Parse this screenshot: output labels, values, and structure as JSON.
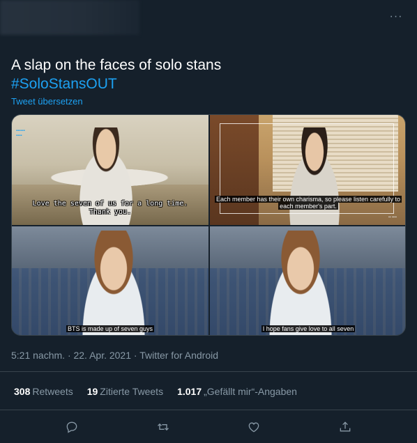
{
  "tweet": {
    "text": "A slap on the faces of solo stans",
    "hashtag": "#SoloStansOUT",
    "translate_label": "Tweet übersetzen",
    "meta": "5:21 nachm. · 22. Apr. 2021 · Twitter for Android"
  },
  "media": {
    "tile1": {
      "subtitle_line1": "Love the seven of us for a long time.",
      "subtitle_line2": "Thank you."
    },
    "tile2": {
      "subtitle_line1": "Each member has their own charisma, so please listen carefully to",
      "subtitle_line2": "each member's part."
    },
    "tile3": {
      "subtitle": "BTS is made up of seven guys"
    },
    "tile4": {
      "subtitle": "I hope fans give love to all seven"
    }
  },
  "stats": {
    "retweets_count": "308",
    "retweets_label": "Retweets",
    "quotes_count": "19",
    "quotes_label": "Zitierte Tweets",
    "likes_count": "1.017",
    "likes_label": "„Gefällt mir“-Angaben"
  },
  "colors": {
    "background": "#15202b",
    "accent": "#1da1f2",
    "secondary_text": "#8899a6",
    "divider": "#38444d"
  },
  "icons": [
    "more-icon",
    "reply-icon",
    "retweet-icon",
    "like-icon",
    "share-icon"
  ]
}
